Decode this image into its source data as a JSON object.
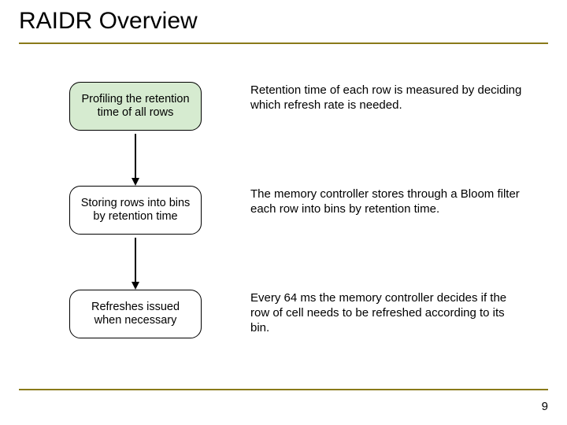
{
  "title": "RAIDR Overview",
  "page_number": "9",
  "steps": [
    {
      "box": "Profiling the retention time of all rows",
      "highlight": true,
      "desc": "Retention time of each row is measured by deciding which refresh rate is needed."
    },
    {
      "box": "Storing rows into bins by retention time",
      "highlight": false,
      "desc": "The memory controller stores through a Bloom filter each row into bins by retention time."
    },
    {
      "box": "Refreshes issued when necessary",
      "highlight": false,
      "desc": "Every 64 ms the memory controller decides if the row of cell needs to be refreshed according to its bin."
    }
  ]
}
